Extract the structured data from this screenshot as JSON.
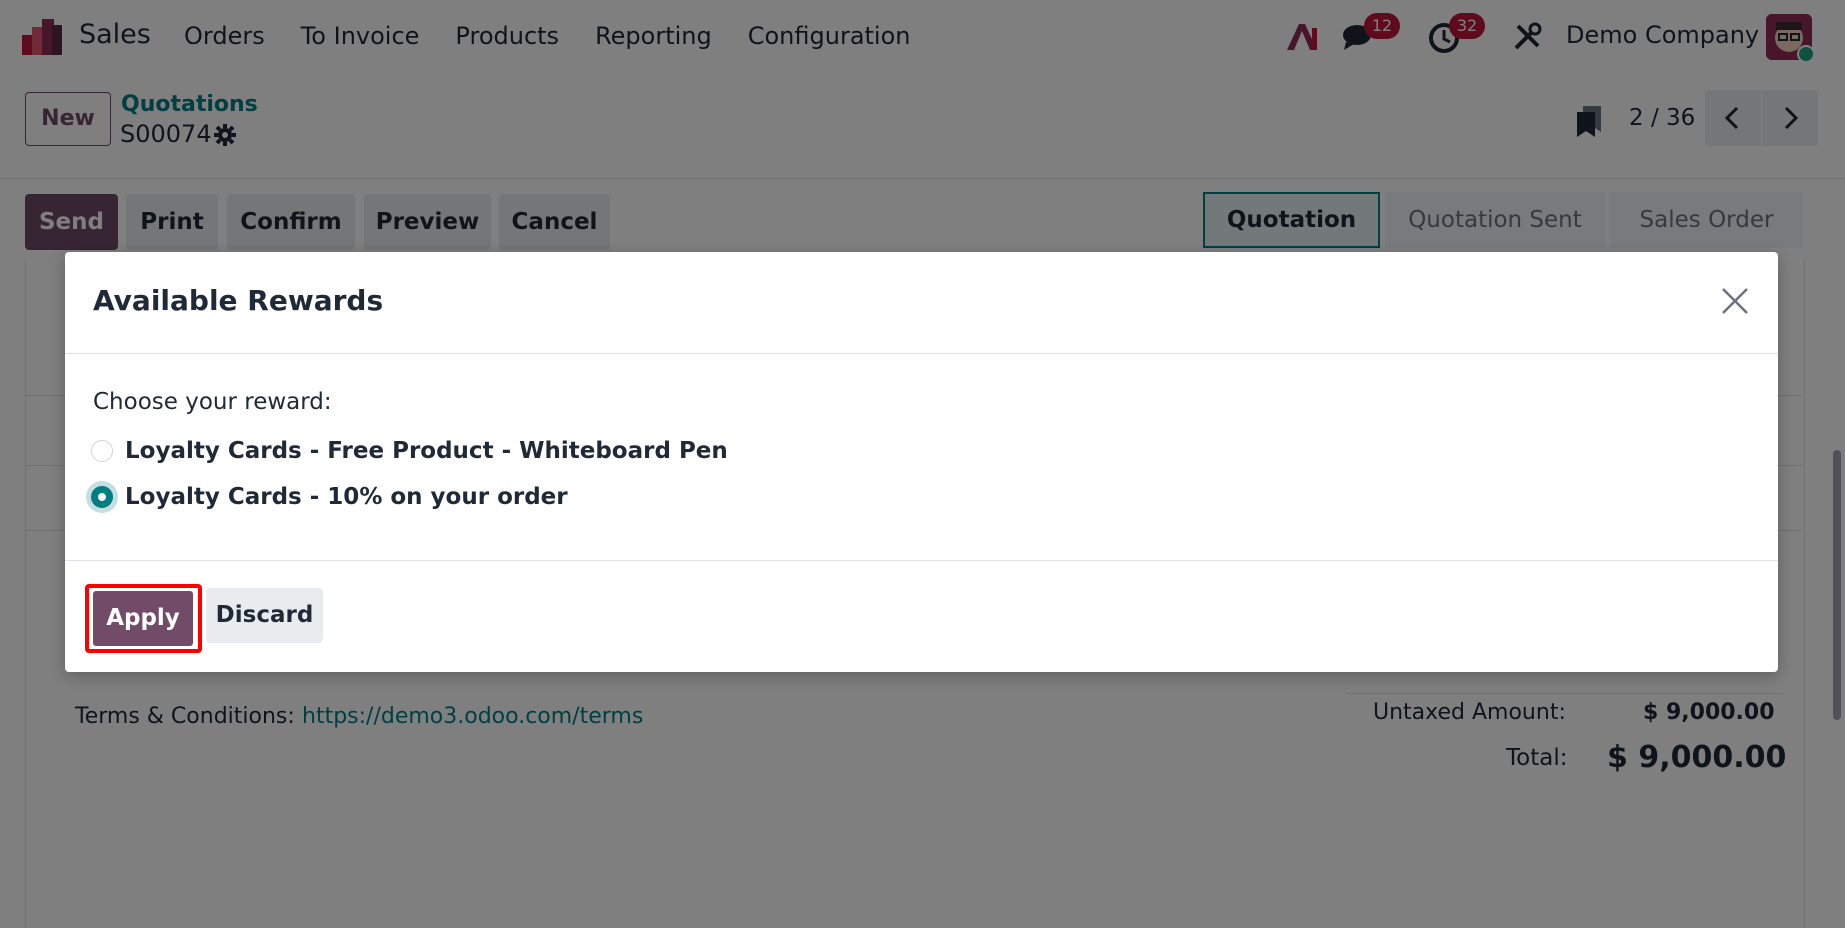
{
  "navbar": {
    "app_name": "Sales",
    "menu": [
      "Orders",
      "To Invoice",
      "Products",
      "Reporting",
      "Configuration"
    ],
    "messages_count": "12",
    "activities_count": "32",
    "company": "Demo Company"
  },
  "control_panel": {
    "new_label": "New",
    "breadcrumb": "Quotations",
    "record_name": "S00074",
    "pager_value": "2 / 36"
  },
  "statusbar": {
    "actions": [
      "Send",
      "Print",
      "Confirm",
      "Preview",
      "Cancel"
    ],
    "stages": [
      "Quotation",
      "Quotation Sent",
      "Sales Order"
    ],
    "active_stage": "Quotation"
  },
  "form": {
    "terms_label": "Terms & Conditions:",
    "terms_link": "https://demo3.odoo.com/terms",
    "untaxed_label": "Untaxed Amount:",
    "untaxed_value": "$ 9,000.00",
    "total_label": "Total:",
    "total_value": "$ 9,000.00"
  },
  "modal": {
    "title": "Available Rewards",
    "prompt": "Choose your reward:",
    "options": [
      {
        "label": "Loyalty Cards - Free Product - Whiteboard Pen",
        "selected": false
      },
      {
        "label": "Loyalty Cards - 10% on your order",
        "selected": true
      }
    ],
    "apply_label": "Apply",
    "discard_label": "Discard"
  },
  "colors": {
    "brand": "#714b67",
    "accent": "#017e84",
    "badge": "#c0173b",
    "highlight_box": "#ff0000"
  }
}
